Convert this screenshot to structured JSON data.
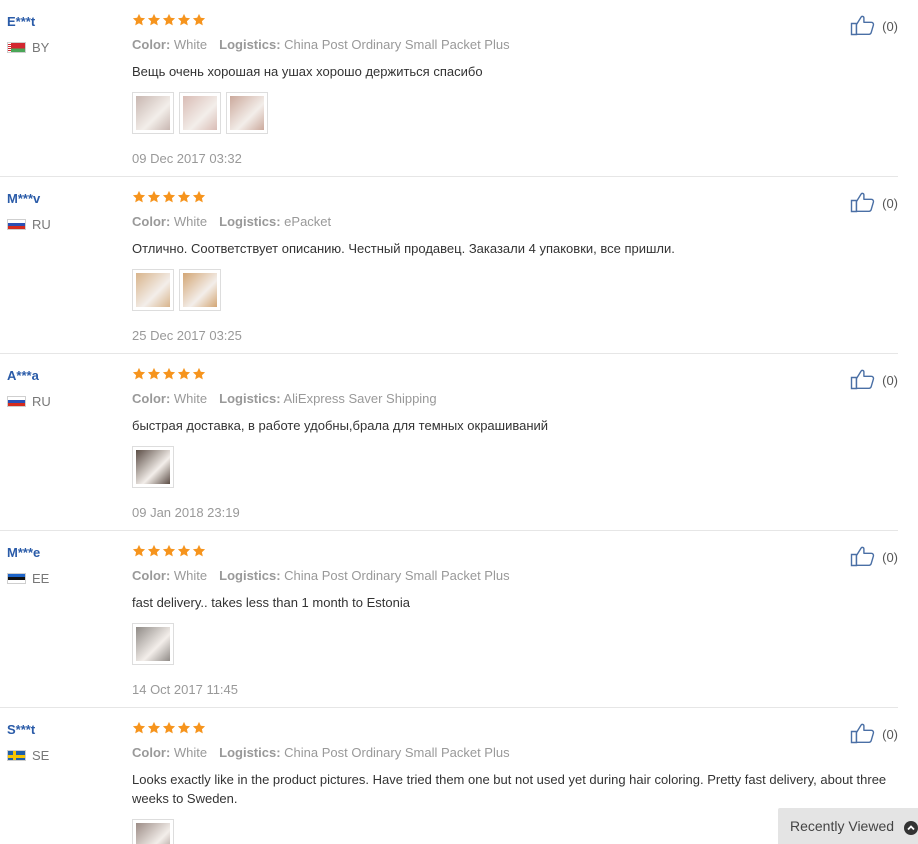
{
  "labels": {
    "color": "Color:",
    "logistics": "Logistics:"
  },
  "reviews": [
    {
      "user": "E***t",
      "country": "BY",
      "flag": "flag-by",
      "rating": 5,
      "color": "White",
      "logistics": "China Post Ordinary Small Packet Plus",
      "text": "Вещь очень хорошая на ушах хорошо держиться спасибо",
      "photo_count": 3,
      "photo_colors": [
        "#c8b7b1",
        "#d9bcb5",
        "#cba99c"
      ],
      "date": "09 Dec 2017 03:32",
      "helpful": "(0)"
    },
    {
      "user": "M***v",
      "country": "RU",
      "flag": "flag-ru",
      "rating": 5,
      "color": "White",
      "logistics": "ePacket",
      "text": "Отлично. Соответствует описанию. Честный продавец. Заказали 4 упаковки, все пришли.",
      "photo_count": 2,
      "photo_colors": [
        "#d8b48b",
        "#d3a674"
      ],
      "date": "25 Dec 2017 03:25",
      "helpful": "(0)"
    },
    {
      "user": "A***a",
      "country": "RU",
      "flag": "flag-ru",
      "rating": 5,
      "color": "White",
      "logistics": "AliExpress Saver Shipping",
      "text": "быстрая доставка, в работе удобны,брала для темных окрашиваний",
      "photo_count": 1,
      "photo_colors": [
        "#5b4d45"
      ],
      "date": "09 Jan 2018 23:19",
      "helpful": "(0)"
    },
    {
      "user": "M***e",
      "country": "EE",
      "flag": "flag-ee",
      "rating": 5,
      "color": "White",
      "logistics": "China Post Ordinary Small Packet Plus",
      "text": "fast delivery.. takes less than 1 month to Estonia",
      "photo_count": 1,
      "photo_colors": [
        "#8f8a86"
      ],
      "date": "14 Oct 2017 11:45",
      "helpful": "(0)"
    },
    {
      "user": "S***t",
      "country": "SE",
      "flag": "flag-se",
      "rating": 5,
      "color": "White",
      "logistics": "China Post Ordinary Small Packet Plus",
      "text": "Looks exactly like in the product pictures. Have tried them one but not used yet during hair coloring. Pretty fast delivery, about three weeks to Sweden.",
      "photo_count": 1,
      "photo_colors": [
        "#9c8c86"
      ],
      "date": "",
      "helpful": "(0)"
    }
  ],
  "recently_viewed": {
    "label": "Recently Viewed",
    "icon": "chevron-up-icon"
  },
  "colors": {
    "star": "#f6941d",
    "user_link": "#2a5ba8",
    "meta": "#999999"
  }
}
